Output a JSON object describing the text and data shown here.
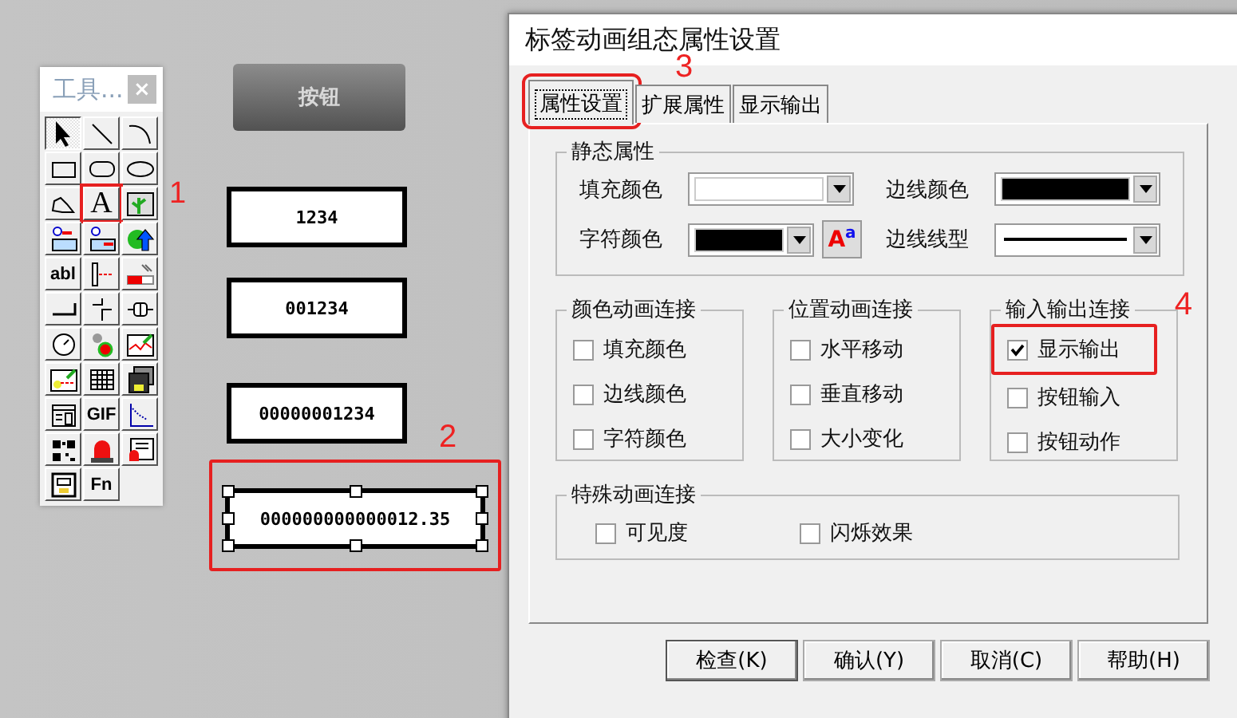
{
  "toolbox": {
    "title": "工具...",
    "close": "×",
    "tools": [
      {
        "kind": "pointer",
        "selected": true
      },
      {
        "kind": "line",
        "selected": false
      },
      {
        "kind": "arc",
        "selected": false
      },
      {
        "kind": "rect",
        "selected": false
      },
      {
        "kind": "rounded-rect",
        "selected": false
      },
      {
        "kind": "ellipse",
        "selected": false
      },
      {
        "kind": "polygon",
        "selected": false
      },
      {
        "kind": "letter",
        "label": "A",
        "selected": false,
        "highlighted": true,
        "annotation": "1"
      },
      {
        "kind": "bitmap",
        "selected": false
      },
      {
        "kind": "data-input",
        "selected": false
      },
      {
        "kind": "data-output",
        "selected": false
      },
      {
        "kind": "globe",
        "selected": false
      },
      {
        "kind": "letter",
        "label": "abl",
        "selected": false
      },
      {
        "kind": "slider",
        "selected": false
      },
      {
        "kind": "bar",
        "selected": false
      },
      {
        "kind": "push-button",
        "selected": false
      },
      {
        "kind": "switch",
        "selected": false
      },
      {
        "kind": "valve",
        "selected": false
      },
      {
        "kind": "gauge",
        "selected": false
      },
      {
        "kind": "lights",
        "selected": false
      },
      {
        "kind": "trend",
        "selected": false
      },
      {
        "kind": "history",
        "selected": false
      },
      {
        "kind": "grid",
        "selected": false
      },
      {
        "kind": "disk",
        "selected": false
      },
      {
        "kind": "form",
        "selected": false
      },
      {
        "kind": "letter",
        "label": "GIF",
        "selected": false
      },
      {
        "kind": "xy-plot",
        "selected": false
      },
      {
        "kind": "qr",
        "selected": false
      },
      {
        "kind": "alarm",
        "selected": false
      },
      {
        "kind": "alarm-window",
        "selected": false
      },
      {
        "kind": "report",
        "selected": false
      },
      {
        "kind": "letter",
        "label": "Fn",
        "selected": false
      }
    ]
  },
  "canvas": {
    "button": {
      "label": "按钮"
    },
    "displays": [
      {
        "value": "1234",
        "selected": false,
        "highlighted": false
      },
      {
        "value": "001234",
        "selected": false,
        "highlighted": false
      },
      {
        "value": "00000001234",
        "selected": false,
        "highlighted": false
      },
      {
        "value": "000000000000012.35",
        "selected": true,
        "highlighted": true,
        "annotation": "2"
      }
    ]
  },
  "dialog": {
    "title": "标签动画组态属性设置",
    "tabs": [
      {
        "label": "属性设置",
        "selected": true,
        "highlighted": true,
        "annotation": "3"
      },
      {
        "label": "扩展属性",
        "selected": false,
        "highlighted": false
      },
      {
        "label": "显示输出",
        "selected": false,
        "highlighted": false
      }
    ],
    "static_group": {
      "title": "静态属性",
      "fields": [
        {
          "label": "填充颜色",
          "kind": "color",
          "color": "#ffffff"
        },
        {
          "label": "边线颜色",
          "kind": "color",
          "color": "#000000"
        },
        {
          "label": "字符颜色",
          "kind": "color",
          "color": "#000000",
          "font_button": "A$^{a}$"
        },
        {
          "label": "边线线型",
          "kind": "line"
        }
      ]
    },
    "groups": [
      {
        "title": "颜色动画连接",
        "options": [
          {
            "label": "填充颜色",
            "checked": false
          },
          {
            "label": "边线颜色",
            "checked": false
          },
          {
            "label": "字符颜色",
            "checked": false
          }
        ]
      },
      {
        "title": "位置动画连接",
        "options": [
          {
            "label": "水平移动",
            "checked": false
          },
          {
            "label": "垂直移动",
            "checked": false
          },
          {
            "label": "大小变化",
            "checked": false
          }
        ]
      },
      {
        "title": "输入输出连接",
        "annotation": "4",
        "options": [
          {
            "label": "显示输出",
            "checked": true,
            "highlighted": true
          },
          {
            "label": "按钮输入",
            "checked": false
          },
          {
            "label": "按钮动作",
            "checked": false
          }
        ]
      }
    ],
    "special_group": {
      "title": "特殊动画连接",
      "options": [
        {
          "label": "可见度",
          "checked": false
        },
        {
          "label": "闪烁效果",
          "checked": false
        }
      ]
    },
    "buttons": [
      {
        "label": "检查(K)",
        "default": true
      },
      {
        "label": "确认(Y)",
        "default": false
      },
      {
        "label": "取消(C)",
        "default": false
      },
      {
        "label": "帮助(H)",
        "default": false
      }
    ]
  }
}
